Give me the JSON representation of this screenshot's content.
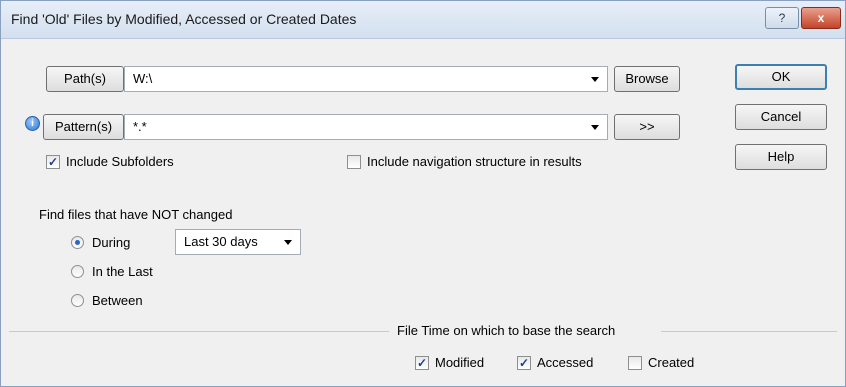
{
  "window": {
    "title": "Find 'Old' Files by Modified, Accessed or Created Dates",
    "help_glyph": "?",
    "close_glyph": "x"
  },
  "paths": {
    "button_label": "Path(s)",
    "value": "W:\\",
    "browse_label": "Browse"
  },
  "patterns": {
    "info_glyph": "i",
    "button_label": "Pattern(s)",
    "value": "*.*",
    "more_label": ">>"
  },
  "options": {
    "include_subfolders": {
      "label": "Include Subfolders",
      "checked": true
    },
    "include_navigation": {
      "label": "Include navigation structure in results",
      "checked": false
    }
  },
  "actions": {
    "ok_label": "OK",
    "cancel_label": "Cancel",
    "help_label": "Help"
  },
  "not_changed": {
    "heading": "Find files that have NOT changed",
    "during_label": "During",
    "during_selected": true,
    "during_value": "Last 30 days",
    "in_the_last_label": "In the Last",
    "between_label": "Between"
  },
  "file_time": {
    "group_label": "File Time on which to base the search",
    "modified": {
      "label": "Modified",
      "checked": true
    },
    "accessed": {
      "label": "Accessed",
      "checked": true
    },
    "created": {
      "label": "Created",
      "checked": false
    }
  }
}
